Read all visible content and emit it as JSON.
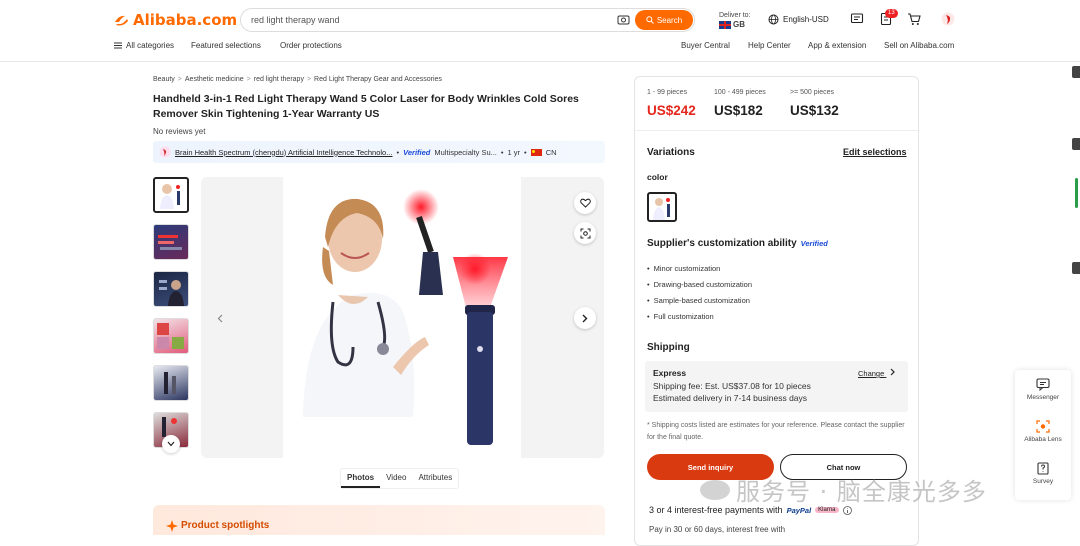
{
  "header": {
    "logo_text": "Alibaba.com",
    "search_value": "red light therapy wand",
    "search_button": "Search",
    "deliver_to_label": "Deliver to:",
    "deliver_country": "GB",
    "language": "English-USD",
    "cart_badge": "13"
  },
  "nav": {
    "categories": "All categories",
    "featured": "Featured selections",
    "protections": "Order protections",
    "buyer_central": "Buyer Central",
    "help": "Help Center",
    "app": "App & extension",
    "sell": "Sell on Alibaba.com"
  },
  "breadcrumb": [
    "Beauty",
    "Aesthetic medicine",
    "red light therapy",
    "Red Light Therapy Gear and Accessories"
  ],
  "product": {
    "title": "Handheld 3-in-1 Red Light Therapy Wand 5 Color Laser for Body Wrinkles Cold Sores Remover Skin Tightening 1-Year Warranty US",
    "reviews": "No reviews yet",
    "supplier_name": "Brain Health Spectrum (chengdu) Artificial Intelligence Technolo...",
    "verified": "Verified",
    "supplier_type": "Multispecialty Su...",
    "years": "1 yr",
    "country": "CN"
  },
  "media_tabs": [
    "Photos",
    "Video",
    "Attributes"
  ],
  "spotlights": "Product spotlights",
  "pricing": [
    {
      "range": "1 - 99 pieces",
      "price": "US$242"
    },
    {
      "range": "100 - 499 pieces",
      "price": "US$182"
    },
    {
      "range": ">= 500 pieces",
      "price": "US$132"
    }
  ],
  "variations": {
    "title": "Variations",
    "edit": "Edit selections",
    "color_label": "color"
  },
  "customization": {
    "title": "Supplier's customization ability",
    "verified": "Verified",
    "items": [
      "Minor customization",
      "Drawing-based customization",
      "Sample-based customization",
      "Full customization"
    ]
  },
  "shipping": {
    "title": "Shipping",
    "method": "Express",
    "change": "Change",
    "fee": "Shipping fee: Est. US$37.08 for 10 pieces",
    "delivery": "Estimated delivery in 7-14 business days",
    "note": "* Shipping costs listed are estimates for your reference. Please contact the supplier for the final quote."
  },
  "actions": {
    "inquiry": "Send inquiry",
    "chat": "Chat now"
  },
  "payments": {
    "line1": "3 or 4 interest-free payments with",
    "paypal": "PayPal",
    "klarna": "Klarna",
    "line2": "Pay in 30 or 60 days, interest free with"
  },
  "rail": {
    "messenger": "Messenger",
    "lens": "Alibaba Lens",
    "survey": "Survey"
  },
  "watermark": "服务号 · 脑全康光多多",
  "colors": {
    "brand": "#ff6a00",
    "price_red": "#e4261c",
    "inquiry": "#d93a10"
  }
}
